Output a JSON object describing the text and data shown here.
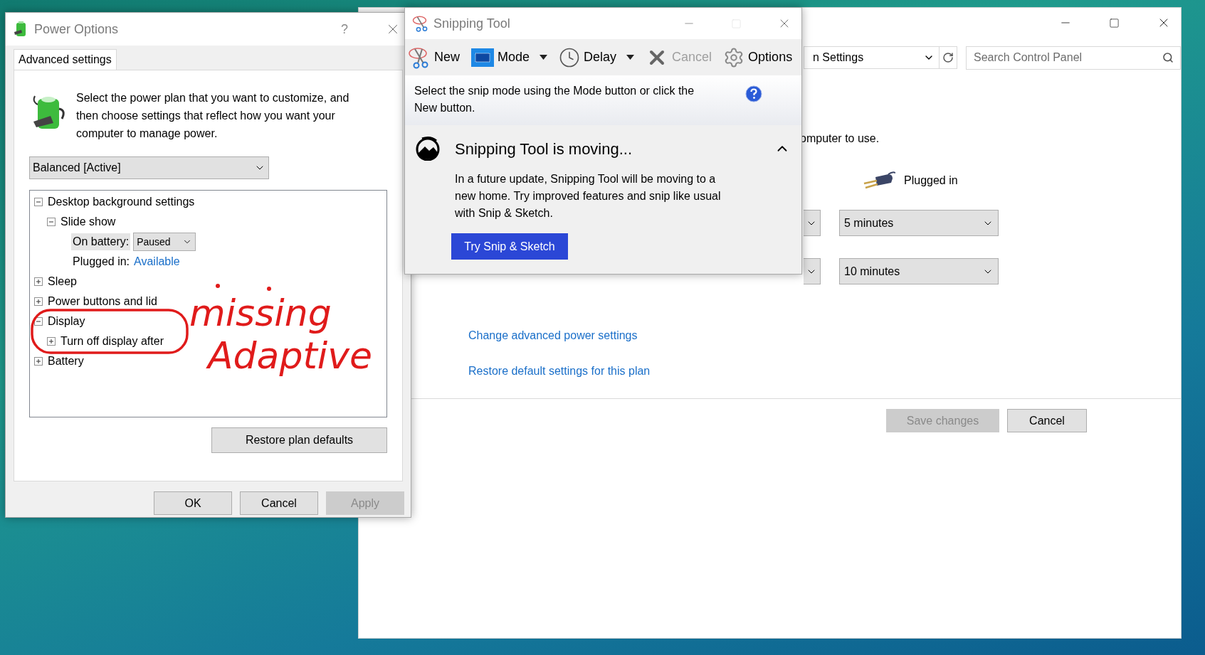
{
  "control_panel": {
    "address": "n Settings",
    "search": {
      "placeholder": "Search Control Panel"
    },
    "intro_text": "omputer to use.",
    "plugged_in_label": "Plugged in",
    "settings": [
      {
        "value": "5 minutes"
      },
      {
        "value": "10 minutes"
      }
    ],
    "links": [
      "Change advanced power settings",
      "Restore default settings for this plan"
    ],
    "buttons": [
      {
        "label": "Save changes",
        "disabled": true
      },
      {
        "label": "Cancel",
        "disabled": false
      }
    ]
  },
  "power_options": {
    "title": "Power Options",
    "help": "?",
    "tabs": [
      {
        "label": "Advanced settings",
        "selected": true
      }
    ],
    "description": "Select the power plan that you want to customize, and then choose settings that reflect how you want your computer to manage power.",
    "plan": "Balanced [Active]",
    "tree": [
      {
        "kind": "group",
        "label": "Desktop background settings",
        "expanded": true,
        "selected": false,
        "children": [
          {
            "kind": "group",
            "label": "Slide show",
            "expanded": true,
            "selected": false,
            "children": [
              {
                "kind": "select",
                "label": "On battery:",
                "value": "Paused",
                "selected": true
              },
              {
                "kind": "link",
                "label": "Plugged in:",
                "value": "Available",
                "selected": false
              }
            ]
          }
        ]
      },
      {
        "kind": "group",
        "label": "Sleep",
        "expanded": false,
        "selected": false
      },
      {
        "kind": "group",
        "label": "Power buttons and lid",
        "expanded": false,
        "selected": false
      },
      {
        "kind": "group",
        "label": "Display",
        "expanded": true,
        "selected": false,
        "circled": true,
        "children": [
          {
            "kind": "group",
            "label": "Turn off display after",
            "expanded": false,
            "selected": false
          }
        ]
      },
      {
        "kind": "group",
        "label": "Battery",
        "expanded": false,
        "selected": false
      }
    ],
    "restore_button": "Restore plan defaults",
    "buttons": [
      {
        "label": "OK",
        "disabled": false
      },
      {
        "label": "Cancel",
        "disabled": false
      },
      {
        "label": "Apply",
        "disabled": true
      }
    ]
  },
  "snipping_tool": {
    "title": "Snipping Tool",
    "toolbar": [
      {
        "kind": "new",
        "label": "New",
        "dropdown": false,
        "disabled": false
      },
      {
        "kind": "mode",
        "label": "Mode",
        "dropdown": true,
        "disabled": false
      },
      {
        "kind": "delay",
        "label": "Delay",
        "dropdown": true,
        "disabled": false
      },
      {
        "kind": "cancel",
        "label": "Cancel",
        "dropdown": false,
        "disabled": true
      },
      {
        "kind": "options",
        "label": "Options",
        "dropdown": false,
        "disabled": false
      }
    ],
    "info": "Select the snip mode using the Mode button or click the New button.",
    "notice": {
      "title": "Snipping Tool is moving...",
      "expanded": true,
      "body": "In a future update, Snipping Tool will be moving to a new home. Try improved features and snip like usual with Snip & Sketch.",
      "button": "Try Snip & Sketch"
    }
  },
  "annotation": {
    "lines": [
      "missing",
      "Adaptive"
    ]
  }
}
